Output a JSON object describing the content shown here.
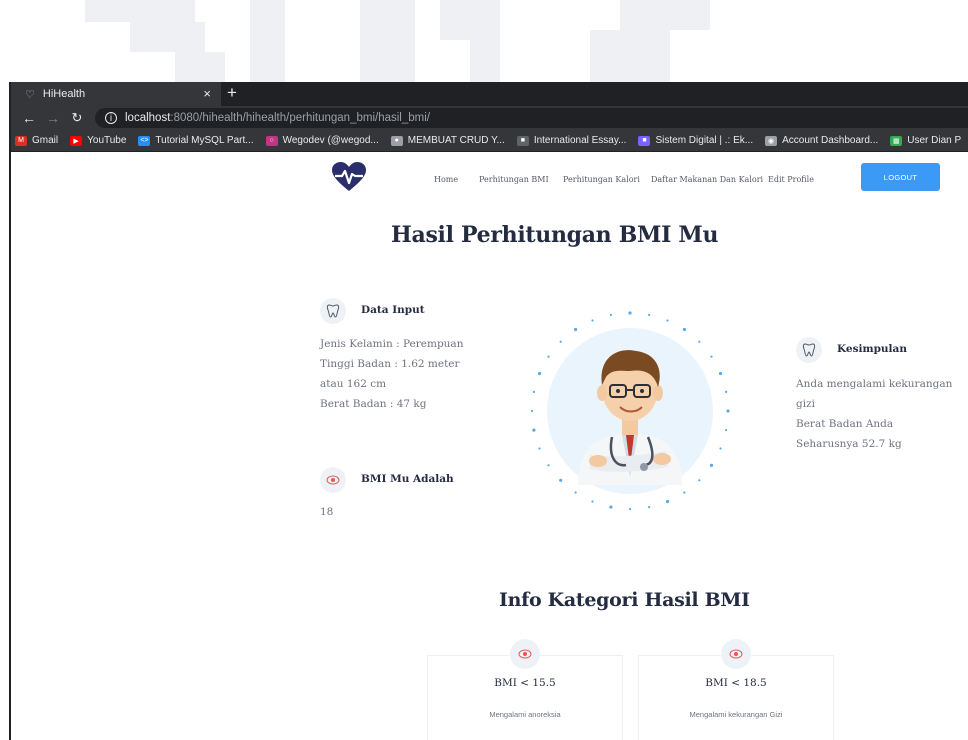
{
  "browser": {
    "tab_title": "HiHealth",
    "tab_close": "×",
    "new_tab": "+",
    "url_host": "localhost",
    "url_path": ":8080/hihealth/hihealth/perhitungan_bmi/hasil_bmi/",
    "bookmarks": [
      {
        "label": "Gmail",
        "icon": "gmail-icon",
        "color": "#d93025"
      },
      {
        "label": "YouTube",
        "icon": "youtube-icon",
        "color": "#ff0000"
      },
      {
        "label": "Tutorial MySQL Part...",
        "icon": "code-icon",
        "color": "#2d8cf0"
      },
      {
        "label": "Wegodev (@wegod...",
        "icon": "instagram-icon",
        "color": "#c13584"
      },
      {
        "label": "MEMBUAT CRUD Y...",
        "icon": "pin-icon",
        "color": "#9aa0a6"
      },
      {
        "label": "International Essay...",
        "icon": "page-icon",
        "color": "#5f6368"
      },
      {
        "label": "Sistem Digital | .: Ek...",
        "icon": "image-icon",
        "color": "#7b61ff"
      },
      {
        "label": "Account Dashboard...",
        "icon": "globe-icon",
        "color": "#9aa0a6"
      },
      {
        "label": "User Dian P",
        "icon": "grid-icon",
        "color": "#34a853"
      }
    ]
  },
  "nav": {
    "items": [
      "Home",
      "Perhitungan BMI",
      "Perhitungan Kalori",
      "Daftar Makanan Dan Kalori",
      "Edit Profile"
    ],
    "logout": "LOGOUT"
  },
  "colors": {
    "brand_navy": "#2a2f6b",
    "accent_blue": "#3b9af5",
    "heading": "#252c41",
    "icon_red": "#e05a5a"
  },
  "main": {
    "title": "Hasil Perhitungan BMI Mu",
    "data_input": {
      "title": "Data Input",
      "lines": [
        "Jenis Kelamin : Perempuan",
        "Tinggi Badan : 1.62 meter",
        "atau 162 cm",
        "Berat Badan : 47 kg"
      ]
    },
    "bmi": {
      "title": "BMI Mu Adalah",
      "value": "18"
    },
    "kesimpulan": {
      "title": "Kesimpulan",
      "lines": [
        "Anda mengalami kekurangan",
        "gizi",
        "Berat Badan Anda",
        "Seharusnya 52.7 kg"
      ]
    }
  },
  "info": {
    "title": "Info Kategori Hasil BMI",
    "cards": [
      {
        "title": "BMI < 15.5",
        "desc": "Mengalami anoreksia"
      },
      {
        "title": "BMI < 18.5",
        "desc": "Mengalami kekurangan Gizi"
      }
    ]
  }
}
